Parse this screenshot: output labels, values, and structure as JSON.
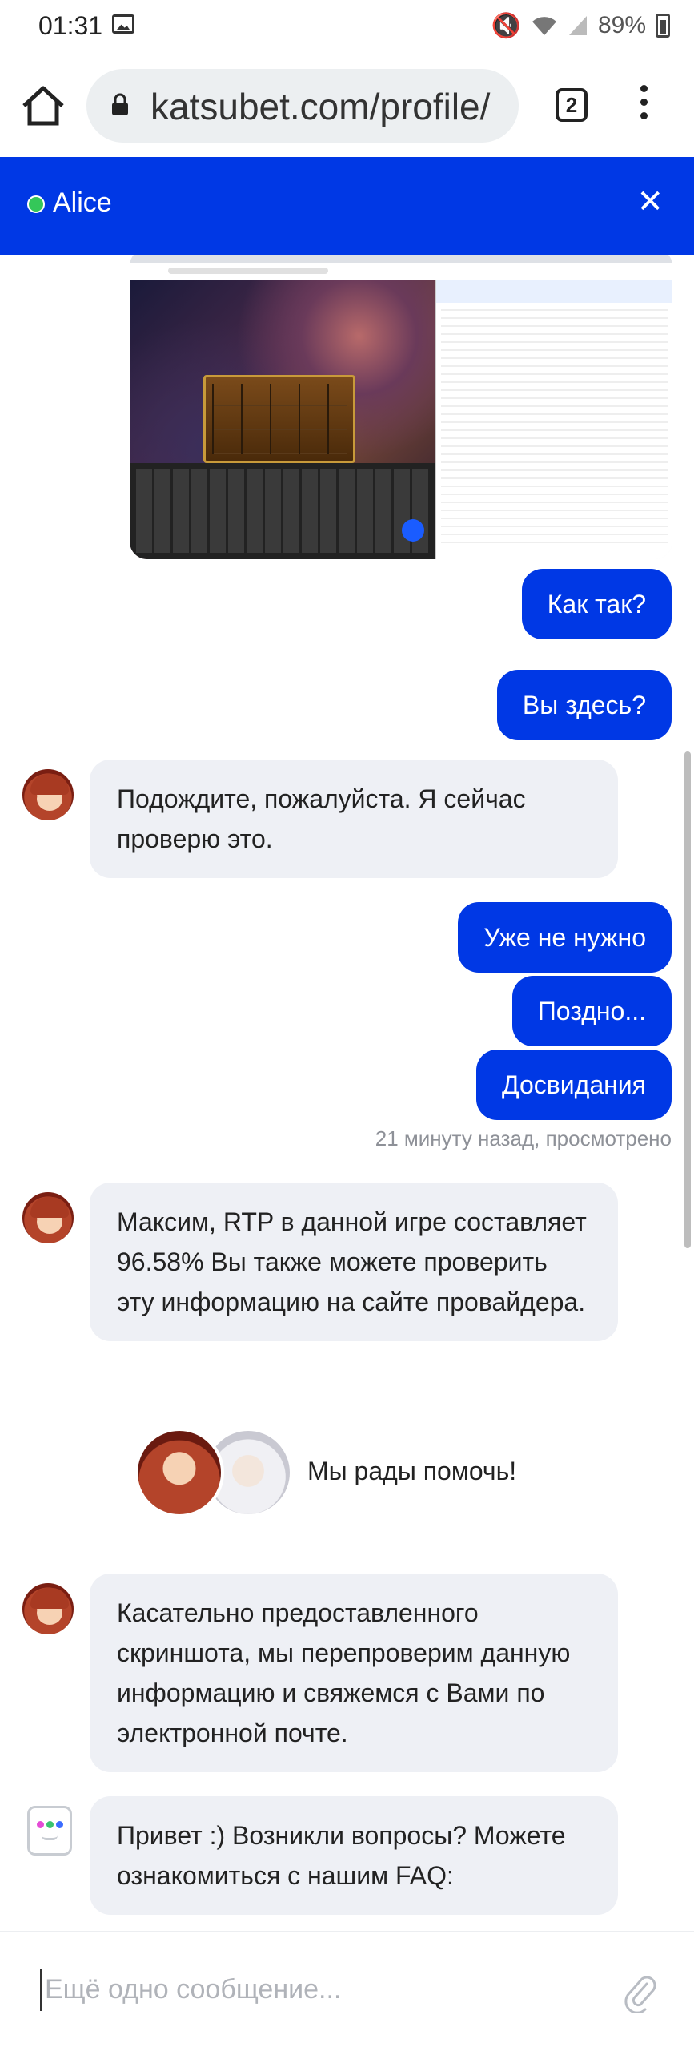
{
  "status_bar": {
    "time": "01:31",
    "battery": "89%",
    "icons": [
      "gallery-icon",
      "mute-icon",
      "wifi-icon",
      "signal-icon",
      "battery-icon"
    ]
  },
  "browser": {
    "url": "katsubet.com/profile/",
    "tab_count": "2"
  },
  "chat_header": {
    "agent_name": "Alice",
    "status_color": "#34c759",
    "accent_color": "#0038e5"
  },
  "messages": {
    "out_1": "Как так?",
    "out_2": "Вы здесь?",
    "in_1": "Подождите, пожалуйста. Я сейчас проверю это.",
    "out_3": "Уже не нужно",
    "out_4": "Поздно...",
    "out_5": "Досвидания",
    "timestamp": "21 минуту назад, просмотрено",
    "in_2": "Максим, RTP в данной игре составляет 96.58% Вы также можете проверить эту информацию на сайте провайдера.",
    "team_text": "Мы рады помочь!",
    "in_3": "Касательно предоставленного скриншота, мы перепроверим данную информацию и свяжемся с Вами по электронной почте.",
    "bot_1": "Привет :) Возникли вопросы? Можете ознакомиться с нашим FAQ:"
  },
  "composer": {
    "placeholder": "Ещё одно сообщение..."
  }
}
